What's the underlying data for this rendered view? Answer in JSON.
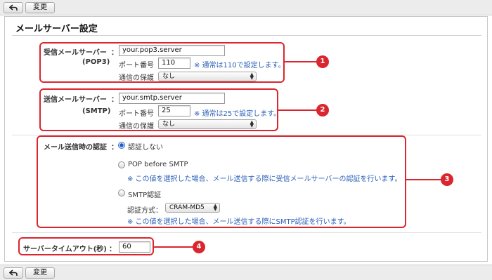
{
  "toolbar": {
    "change_label": "変更"
  },
  "page_title": "メールサーバー設定",
  "colon": "：",
  "pop": {
    "label": "受信メールサーバー",
    "sublabel": "(POP3)",
    "server_value": "your.pop3.server",
    "port_label": "ポート番号",
    "port_value": "110",
    "port_note": "※ 通常は110で設定します。",
    "security_label": "通信の保護",
    "security_value": "なし"
  },
  "smtp": {
    "label": "送信メールサーバー",
    "sublabel": "(SMTP)",
    "server_value": "your.smtp.server",
    "port_label": "ポート番号",
    "port_value": "25",
    "port_note": "※ 通常は25で設定します。",
    "security_label": "通信の保護",
    "security_value": "なし"
  },
  "auth": {
    "label": "メール送信時の認証",
    "options": [
      {
        "label": "認証しない",
        "selected": true
      },
      {
        "label": "POP before SMTP",
        "selected": false,
        "note": "※ この値を選択した場合、メール送信する際に受信メールサーバーの認証を行います。"
      },
      {
        "label": "SMTP認証",
        "selected": false,
        "note": "※ この値を選択した場合、メール送信する際にSMTP認証を行います。"
      }
    ],
    "method_label": "認証方式：",
    "method_value": "CRAM-MD5"
  },
  "timeout": {
    "label": "サーバータイムアウト(秒)",
    "value": "60"
  },
  "callouts": [
    "1",
    "2",
    "3",
    "4"
  ],
  "colors": {
    "callout": "#d9262f",
    "note": "#2a5fb8"
  }
}
